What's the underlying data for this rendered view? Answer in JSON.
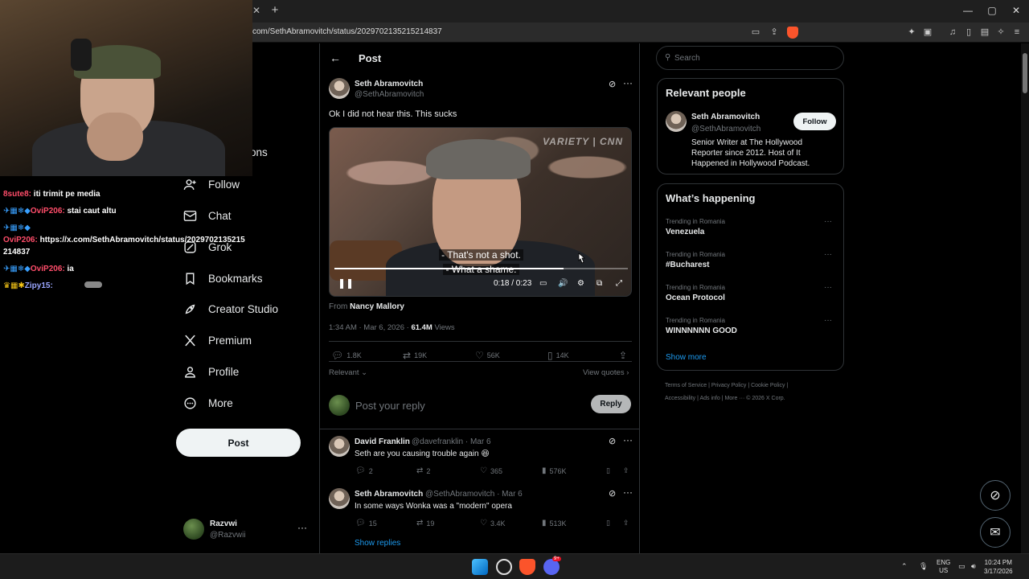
{
  "browser": {
    "url": "com/SethAbramovitch/status/2029702135215214837",
    "window_controls": [
      "—",
      "▢",
      "✕"
    ]
  },
  "stream_overlay": {
    "chat": [
      {
        "user": "8sute8:",
        "message": "iti trimit pe media",
        "badges": ""
      },
      {
        "user": "OviP206:",
        "message": "stai caut altu",
        "badges": "✈▦❄◆"
      },
      {
        "user": "",
        "message": "",
        "badges": "✈▦❄◆"
      },
      {
        "user": "OviP206:",
        "message": "https://x.com/SethAbramovitch/status/2029702135215",
        "badges": ""
      },
      {
        "user": "",
        "message": "214837",
        "badges": ""
      },
      {
        "user": "OviP206:",
        "message": "ia",
        "badges": "✈▦❄◆"
      },
      {
        "user": "Zipy15:",
        "message": "",
        "badges": "♛▦✱"
      }
    ],
    "cut_label": "ons"
  },
  "nav": {
    "items": [
      {
        "label": "Follow",
        "icon": "follow-icon"
      },
      {
        "label": "Chat",
        "icon": "chat-icon"
      },
      {
        "label": "Grok",
        "icon": "grok-icon"
      },
      {
        "label": "Bookmarks",
        "icon": "bookmark-icon"
      },
      {
        "label": "Creator Studio",
        "icon": "rocket-icon"
      },
      {
        "label": "Premium",
        "icon": "x-icon"
      },
      {
        "label": "Profile",
        "icon": "person-icon"
      },
      {
        "label": "More",
        "icon": "more-icon"
      }
    ],
    "post_label": "Post",
    "account": {
      "name": "Razvwi",
      "handle": "@Razvwii"
    }
  },
  "post": {
    "header_title": "Post",
    "author": {
      "name": "Seth Abramovitch",
      "handle": "@SethAbramovitch"
    },
    "text": "Ok I did not hear this. This sucks",
    "video": {
      "watermark": "VARIETY | CNN",
      "subtitle_1": "- That's not a shot.",
      "subtitle_2": "- What a shame.",
      "time": "0:18 / 0:23",
      "progress": 0.78
    },
    "from_label": "From",
    "from_name": "Nancy Mallory",
    "timestamp": "1:34 AM · Mar 6, 2026 · ",
    "views_count": "61.4M",
    "views_label": " Views",
    "actions": {
      "replies": "1.8K",
      "reposts": "19K",
      "likes": "56K",
      "bookmarks": "14K"
    },
    "sort_label": "Relevant",
    "view_quotes": "View quotes"
  },
  "reply_box": {
    "placeholder": "Post your reply",
    "button": "Reply"
  },
  "comments": [
    {
      "name": "David Franklin",
      "handle": "@davefranklin · Mar 6",
      "text": "Seth are you causing trouble again 😆",
      "replies": "2",
      "reposts": "2",
      "likes": "365",
      "views": "576K"
    },
    {
      "name": "Seth Abramovitch",
      "handle": "@SethAbramovitch · Mar 6",
      "text": "In some ways Wonka was a \"modern\" opera",
      "replies": "15",
      "reposts": "19",
      "likes": "3.4K",
      "views": "513K"
    }
  ],
  "show_replies": "Show replies",
  "sidebar": {
    "search_placeholder": "Search",
    "relevant_title": "Relevant people",
    "relevant_person": {
      "name": "Seth Abramovitch",
      "handle": "@SethAbramovitch",
      "bio": "Senior Writer at The Hollywood Reporter since 2012. Host of It Happened in Hollywood Podcast.",
      "follow": "Follow"
    },
    "happening_title": "What’s happening",
    "trends": [
      {
        "context": "Trending in Romania",
        "name": "Venezuela"
      },
      {
        "context": "Trending in Romania",
        "name": "#Bucharest"
      },
      {
        "context": "Trending in Romania",
        "name": "Ocean Protocol"
      },
      {
        "context": "Trending in Romania",
        "name": "WINNNNNN GOOD"
      }
    ],
    "show_more": "Show more",
    "footer_1": "Terms of Service  |  Privacy Policy  |  Cookie Policy  |",
    "footer_2": "Accessibility  |  Ads info  |  More ···  ©  2026 X Corp."
  },
  "taskbar": {
    "lang_1": "ENG",
    "lang_2": "US",
    "time": "10:24 PM",
    "date": "3/17/2026",
    "discord_badge": "9+"
  },
  "colors": {
    "accent": "#1d9bf0",
    "background": "#000000",
    "border": "#2f3336",
    "muted": "#71767b",
    "brave": "#fb542b"
  }
}
